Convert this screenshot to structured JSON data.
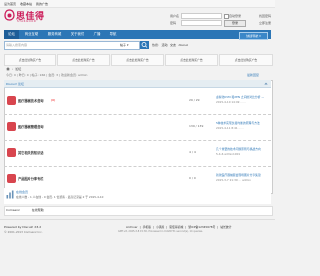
{
  "topbar": {
    "items": [
      "设为首页",
      "收藏本站",
      "我的广告"
    ]
  },
  "header": {
    "logo_cn": "思佳得",
    "logo_en": "STARGOOD",
    "brand_color": "#cc1d5a"
  },
  "login": {
    "username_label": "用户名",
    "password_label": "密码",
    "auto_login": "自动登录",
    "find_password": "找回密码",
    "login_button": "登录",
    "register": "立即注册"
  },
  "nav": {
    "items": [
      "论坛",
      "商业互助",
      "服务商城",
      "关于我们",
      "广播",
      "导航"
    ],
    "quick_nav": "快捷导航 ▾",
    "accent_color": "#2c76b6"
  },
  "search": {
    "placeholder": "请输入搜索内容",
    "scope": "帖子 ▾",
    "hot_label": "热搜:",
    "hot_terms": [
      "活动",
      "交友",
      "discuz"
    ]
  },
  "ads": [
    "点击此处购买广告",
    "点击此处购买广告",
    "点击此处购买广告",
    "点击此处购买广告",
    "点击此处购买广告"
  ],
  "breadcrumb": [
    "论坛"
  ],
  "stats_line": "今日: 0 | 昨日: 0 | 帖子: 166 | 会员: 3 | 欢迎新会员: admin",
  "stats_right": "最新回复",
  "forum_group": {
    "title": "Discuz! 论坛"
  },
  "forums": [
    {
      "name": "医疗器械技术咨询",
      "new": "(0)",
      "count": "29 / 29",
      "last_post": "虚拟化KVM 和XEN 之间的对比分析 —",
      "last_time": "2015-4-10 14:49 ······",
      "color": "#d8454e"
    },
    {
      "name": "医疗器械管理咨询",
      "new": "",
      "count": "139 / 139",
      "last_post": "5种技术实现负载均衡的原理与方法",
      "last_time": "2015-4-11 8:41 ······",
      "color": "#d8454e"
    },
    {
      "name": "其它相关的知识话",
      "new": "",
      "count": "4 / 4",
      "last_post": "几个重要的技术问题原则与挑战方向",
      "last_time": "5-4-6 admin1001",
      "color": "#d8454e"
    },
    {
      "name": "产品图片分享专栏",
      "new": "",
      "count": "0 / 0",
      "last_post": "新款医疗器械展会现场图片分享集锦",
      "last_time": "2015-3-7 21:39 ··· admin",
      "color": "#d8454e"
    }
  ],
  "info": {
    "title": "在线会员",
    "text": "在线人数 - 1 人在线 - 0 会员, 1 位游客 - 最高记录是 2 于 2015-4-10"
  },
  "links": [
    "Comsenz",
    "在线帮助"
  ],
  "footer": {
    "powered": "Powered by Discuz! X3.2",
    "copyright": "© 2001-2013 Comsenz Inc.",
    "links": [
      "Archiver",
      "手机版",
      "小黑屋",
      "思佳得商城",
      "浙ICP备12345678号",
      "站长统计"
    ],
    "info": "GMT+8, 2025-3-8 15:30, Processed in 0.026731 second(s), 14 queries."
  }
}
